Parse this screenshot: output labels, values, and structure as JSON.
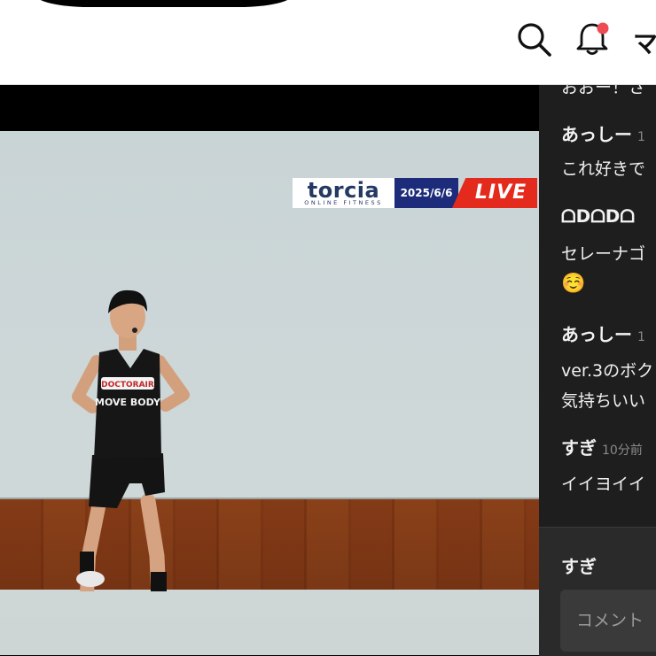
{
  "header": {
    "menu_glyph": "マ"
  },
  "overlay": {
    "brand": "torcia",
    "brand_sub": "ONLINE FITNESS",
    "date": "2025/6/6",
    "live": "LIVE"
  },
  "shirt": {
    "brand": "DOCTORAIR",
    "text": "MOVE BODY"
  },
  "chat": {
    "partial_top": "おおー！さ",
    "messages": [
      {
        "name": "あっしー",
        "time": "1",
        "lines": [
          "これ好きで"
        ]
      },
      {
        "name": "ᗝᗞᗝᗞᗝ",
        "time": "",
        "lines": [
          "セレーナゴ",
          "☺️"
        ]
      },
      {
        "name": "あっしー",
        "time": "1",
        "lines": [
          "ver.3のボク",
          "気持ちいい"
        ]
      },
      {
        "name": "すぎ",
        "time": "10分前",
        "lines": [
          "イイヨイイ"
        ]
      }
    ],
    "footer_name": "すぎ",
    "input_placeholder": "コメント"
  },
  "colors": {
    "live_red": "#e32a1d",
    "date_navy": "#1c2c7a",
    "brand_navy": "#243a63",
    "chat_bg": "#1e1e1e",
    "notification_dot": "#ee4c55"
  },
  "icons": [
    "search-icon",
    "bell-icon",
    "notification-dot"
  ]
}
